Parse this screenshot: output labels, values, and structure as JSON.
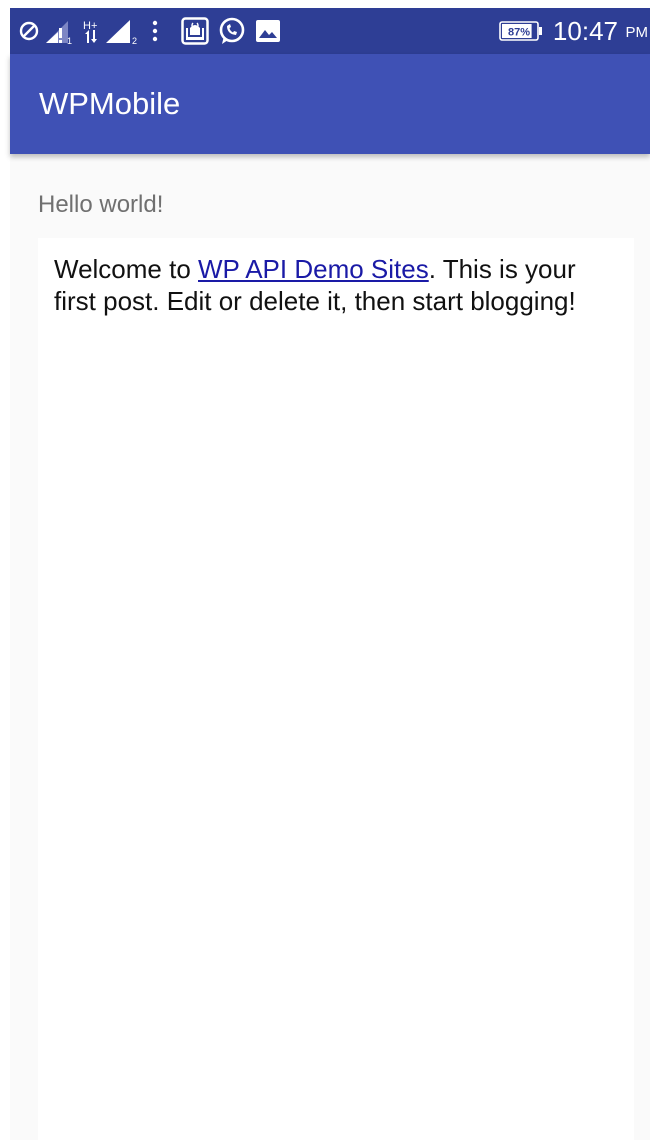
{
  "status_bar": {
    "icons": [
      "do-not-disturb-icon",
      "signal-sim1-icon",
      "data-hplus-icon",
      "signal-sim2-icon",
      "more-vert-icon",
      "prayer-app-icon",
      "whatsapp-icon",
      "image-icon"
    ],
    "battery_percent": "87%",
    "time": "10:47",
    "ampm": "PM"
  },
  "app_bar": {
    "title": "WPMobile",
    "color": "#3f51b5",
    "status_color": "#2e3e95"
  },
  "post": {
    "title": "Hello world!",
    "body_prefix": "Welcome to ",
    "link_text": "WP API Demo Sites",
    "body_suffix": ". This is your first post. Edit or delete it, then start blogging!",
    "link_color": "#1a1aa6"
  }
}
